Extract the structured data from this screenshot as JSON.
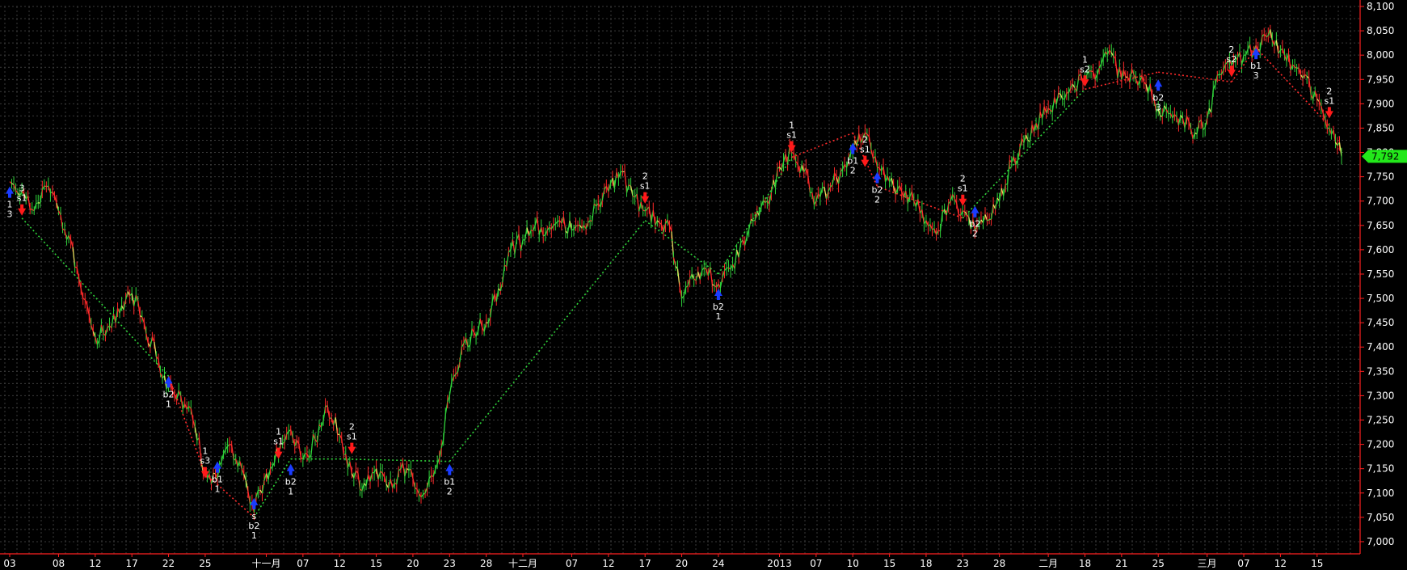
{
  "chart_data": {
    "type": "line",
    "subtype": "intraday price with swing signals",
    "ylim": [
      6975,
      8100
    ],
    "y_ticks": [
      8100,
      8050,
      8000,
      7950,
      7900,
      7850,
      7800,
      7750,
      7700,
      7650,
      7600,
      7550,
      7500,
      7450,
      7400,
      7350,
      7300,
      7250,
      7200,
      7150,
      7100,
      7050,
      7000
    ],
    "y_tick_labels": [
      "8,100",
      "8,050",
      "8,000",
      "7,950",
      "7,900",
      "7,850",
      "7,800",
      "7,750",
      "7,700",
      "7,650",
      "7,600",
      "7,550",
      "7,500",
      "7,450",
      "7,400",
      "7,350",
      "7,300",
      "7,250",
      "7,200",
      "7,150",
      "7,100",
      "7,050",
      "7,000"
    ],
    "x_axis": {
      "ticks": [
        {
          "i": 0,
          "label": "03"
        },
        {
          "i": 4,
          "label": "08"
        },
        {
          "i": 7,
          "label": "12"
        },
        {
          "i": 10,
          "label": "17"
        },
        {
          "i": 13,
          "label": "22"
        },
        {
          "i": 16,
          "label": "25"
        },
        {
          "i": 21,
          "label": "十一月"
        },
        {
          "i": 24,
          "label": "07"
        },
        {
          "i": 27,
          "label": "12"
        },
        {
          "i": 30,
          "label": "15"
        },
        {
          "i": 33,
          "label": "20"
        },
        {
          "i": 36,
          "label": "23"
        },
        {
          "i": 39,
          "label": "28"
        },
        {
          "i": 42,
          "label": "十二月"
        },
        {
          "i": 46,
          "label": "07"
        },
        {
          "i": 49,
          "label": "12"
        },
        {
          "i": 52,
          "label": "17"
        },
        {
          "i": 55,
          "label": "20"
        },
        {
          "i": 58,
          "label": "24"
        },
        {
          "i": 63,
          "label": "2013"
        },
        {
          "i": 66,
          "label": "07"
        },
        {
          "i": 69,
          "label": "10"
        },
        {
          "i": 72,
          "label": "15"
        },
        {
          "i": 75,
          "label": "18"
        },
        {
          "i": 78,
          "label": "23"
        },
        {
          "i": 81,
          "label": "28"
        },
        {
          "i": 85,
          "label": "二月"
        },
        {
          "i": 88,
          "label": "18"
        },
        {
          "i": 91,
          "label": "21"
        },
        {
          "i": 94,
          "label": "25"
        },
        {
          "i": 98,
          "label": "三月"
        },
        {
          "i": 101,
          "label": "07"
        },
        {
          "i": 104,
          "label": "12"
        },
        {
          "i": 107,
          "label": "15"
        }
      ],
      "n_sessions": 110
    },
    "series": [
      {
        "type": "price",
        "colors": {
          "up": "#2fd23a",
          "down": "#ff2a2a",
          "neutral": "#e8e060"
        },
        "points": [
          [
            0,
            7740
          ],
          [
            1,
            7720
          ],
          [
            2,
            7680
          ],
          [
            3,
            7730
          ],
          [
            4,
            7680
          ],
          [
            5,
            7620
          ],
          [
            6,
            7500
          ],
          [
            7,
            7420
          ],
          [
            8,
            7440
          ],
          [
            9,
            7470
          ],
          [
            10,
            7510
          ],
          [
            11,
            7450
          ],
          [
            12,
            7380
          ],
          [
            13,
            7320
          ],
          [
            14,
            7300
          ],
          [
            15,
            7250
          ],
          [
            16,
            7140
          ],
          [
            17,
            7130
          ],
          [
            18,
            7200
          ],
          [
            19,
            7150
          ],
          [
            20,
            7060
          ],
          [
            21,
            7140
          ],
          [
            22,
            7180
          ],
          [
            23,
            7230
          ],
          [
            24,
            7170
          ],
          [
            25,
            7210
          ],
          [
            26,
            7280
          ],
          [
            27,
            7220
          ],
          [
            28,
            7140
          ],
          [
            29,
            7120
          ],
          [
            30,
            7150
          ],
          [
            31,
            7110
          ],
          [
            32,
            7150
          ],
          [
            33,
            7130
          ],
          [
            34,
            7100
          ],
          [
            35,
            7160
          ],
          [
            36,
            7300
          ],
          [
            37,
            7400
          ],
          [
            38,
            7430
          ],
          [
            39,
            7450
          ],
          [
            40,
            7520
          ],
          [
            41,
            7600
          ],
          [
            42,
            7620
          ],
          [
            43,
            7650
          ],
          [
            44,
            7640
          ],
          [
            45,
            7660
          ],
          [
            46,
            7640
          ],
          [
            47,
            7650
          ],
          [
            48,
            7690
          ],
          [
            49,
            7720
          ],
          [
            50,
            7760
          ],
          [
            51,
            7710
          ],
          [
            52,
            7680
          ],
          [
            53,
            7660
          ],
          [
            54,
            7650
          ],
          [
            55,
            7500
          ],
          [
            56,
            7540
          ],
          [
            57,
            7560
          ],
          [
            58,
            7530
          ],
          [
            59,
            7560
          ],
          [
            60,
            7620
          ],
          [
            61,
            7660
          ],
          [
            62,
            7700
          ],
          [
            63,
            7770
          ],
          [
            64,
            7800
          ],
          [
            65,
            7760
          ],
          [
            66,
            7700
          ],
          [
            67,
            7720
          ],
          [
            68,
            7760
          ],
          [
            69,
            7800
          ],
          [
            70,
            7840
          ],
          [
            71,
            7770
          ],
          [
            72,
            7740
          ],
          [
            73,
            7720
          ],
          [
            74,
            7700
          ],
          [
            75,
            7660
          ],
          [
            76,
            7640
          ],
          [
            77,
            7700
          ],
          [
            78,
            7680
          ],
          [
            79,
            7640
          ],
          [
            80,
            7660
          ],
          [
            81,
            7700
          ],
          [
            82,
            7780
          ],
          [
            83,
            7820
          ],
          [
            84,
            7860
          ],
          [
            85,
            7890
          ],
          [
            86,
            7920
          ],
          [
            87,
            7940
          ],
          [
            88,
            7950
          ],
          [
            89,
            7960
          ],
          [
            90,
            8010
          ],
          [
            91,
            7950
          ],
          [
            92,
            7960
          ],
          [
            93,
            7940
          ],
          [
            94,
            7890
          ],
          [
            95,
            7880
          ],
          [
            96,
            7870
          ],
          [
            97,
            7840
          ],
          [
            98,
            7870
          ],
          [
            99,
            7960
          ],
          [
            100,
            7980
          ],
          [
            101,
            8000
          ],
          [
            102,
            8020
          ],
          [
            103,
            8040
          ],
          [
            104,
            8010
          ],
          [
            105,
            7980
          ],
          [
            106,
            7960
          ],
          [
            107,
            7910
          ],
          [
            108,
            7850
          ],
          [
            109,
            7792
          ]
        ]
      },
      {
        "type": "swing_link",
        "segments": [
          {
            "from": [
              1,
              7665
            ],
            "to": [
              13,
              7340
            ],
            "color": "#2fd23a"
          },
          {
            "from": [
              13,
              7340
            ],
            "to": [
              16,
              7140
            ],
            "color": "#ff2a2a"
          },
          {
            "from": [
              16,
              7140
            ],
            "to": [
              20,
              7050
            ],
            "color": "#ff2a2a"
          },
          {
            "from": [
              20,
              7050
            ],
            "to": [
              23,
              7170
            ],
            "color": "#2fd23a"
          },
          {
            "from": [
              23,
              7170
            ],
            "to": [
              27,
              7170
            ],
            "color": "#2fd23a"
          },
          {
            "from": [
              27,
              7170
            ],
            "to": [
              36,
              7165
            ],
            "color": "#2fd23a"
          },
          {
            "from": [
              36,
              7165
            ],
            "to": [
              52,
              7660
            ],
            "color": "#2fd23a"
          },
          {
            "from": [
              52,
              7660
            ],
            "to": [
              58,
              7550
            ],
            "color": "#2fd23a"
          },
          {
            "from": [
              58,
              7550
            ],
            "to": [
              64,
              7790
            ],
            "color": "#2fd23a"
          },
          {
            "from": [
              64,
              7790
            ],
            "to": [
              69,
              7840
            ],
            "color": "#ff2a2a"
          },
          {
            "from": [
              69,
              7840
            ],
            "to": [
              71,
              7730
            ],
            "color": "#ff2a2a"
          },
          {
            "from": [
              71,
              7730
            ],
            "to": [
              78,
              7665
            ],
            "color": "#ff2a2a"
          },
          {
            "from": [
              78,
              7665
            ],
            "to": [
              88,
              7930
            ],
            "color": "#2fd23a"
          },
          {
            "from": [
              88,
              7930
            ],
            "to": [
              94,
              7965
            ],
            "color": "#ff2a2a"
          },
          {
            "from": [
              94,
              7965
            ],
            "to": [
              100,
              7945
            ],
            "color": "#ff2a2a"
          },
          {
            "from": [
              100,
              7945
            ],
            "to": [
              102,
              8015
            ],
            "color": "#ff2a2a"
          },
          {
            "from": [
              102,
              8015
            ],
            "to": [
              108,
              7855
            ],
            "color": "#ff2a2a"
          }
        ]
      }
    ],
    "signals": [
      {
        "i": 0,
        "price": 7720,
        "dir": "buy",
        "labels": [
          "1",
          "3"
        ],
        "pos": "below"
      },
      {
        "i": 1,
        "price": 7680,
        "dir": "sell",
        "labels": [
          "3",
          "s1"
        ],
        "pos": "above"
      },
      {
        "i": 13,
        "price": 7330,
        "dir": "buy",
        "labels": [
          "b2",
          "1"
        ],
        "pos": "below"
      },
      {
        "i": 16,
        "price": 7140,
        "dir": "sell",
        "labels": [
          "1",
          "s3"
        ],
        "pos": "above"
      },
      {
        "i": 17,
        "price": 7155,
        "dir": "buy",
        "labels": [
          "b1",
          "1"
        ],
        "pos": "below"
      },
      {
        "i": 20,
        "price": 7080,
        "dir": "buy",
        "labels": [
          "s",
          "b2",
          "1"
        ],
        "pos": "below"
      },
      {
        "i": 22,
        "price": 7180,
        "dir": "sell",
        "labels": [
          "1",
          "s1"
        ],
        "pos": "above"
      },
      {
        "i": 23,
        "price": 7150,
        "dir": "buy",
        "labels": [
          "b2",
          "1"
        ],
        "pos": "below"
      },
      {
        "i": 28,
        "price": 7190,
        "dir": "sell",
        "labels": [
          "2",
          "s1"
        ],
        "pos": "above"
      },
      {
        "i": 36,
        "price": 7150,
        "dir": "buy",
        "labels": [
          "b1",
          "2"
        ],
        "pos": "below"
      },
      {
        "i": 52,
        "price": 7705,
        "dir": "sell",
        "labels": [
          "2",
          "s1"
        ],
        "pos": "above"
      },
      {
        "i": 58,
        "price": 7510,
        "dir": "buy",
        "labels": [
          "b2",
          "1"
        ],
        "pos": "below"
      },
      {
        "i": 64,
        "price": 7810,
        "dir": "sell",
        "labels": [
          "1",
          "s1"
        ],
        "pos": "above"
      },
      {
        "i": 69,
        "price": 7810,
        "dir": "buy",
        "labels": [
          "b1",
          "2"
        ],
        "pos": "below"
      },
      {
        "i": 70,
        "price": 7780,
        "dir": "sell",
        "labels": [
          "2",
          "s1"
        ],
        "pos": "above"
      },
      {
        "i": 71,
        "price": 7750,
        "dir": "buy",
        "labels": [
          "b2",
          "2"
        ],
        "pos": "below"
      },
      {
        "i": 78,
        "price": 7700,
        "dir": "sell",
        "labels": [
          "2",
          "s1"
        ],
        "pos": "above"
      },
      {
        "i": 79,
        "price": 7680,
        "dir": "buy",
        "labels": [
          "b2",
          "2"
        ],
        "pos": "below"
      },
      {
        "i": 88,
        "price": 7945,
        "dir": "sell",
        "labels": [
          "1",
          "s2"
        ],
        "pos": "above"
      },
      {
        "i": 94,
        "price": 7940,
        "dir": "buy",
        "labels": [
          "b2",
          "3"
        ],
        "pos": "below"
      },
      {
        "i": 100,
        "price": 7965,
        "dir": "sell",
        "labels": [
          "2",
          "s2"
        ],
        "pos": "above"
      },
      {
        "i": 102,
        "price": 8005,
        "dir": "buy",
        "labels": [
          "b1",
          "3"
        ],
        "pos": "below"
      },
      {
        "i": 108,
        "price": 7880,
        "dir": "sell",
        "labels": [
          "2",
          "s1"
        ],
        "pos": "above"
      }
    ],
    "last_price": {
      "value": 7792,
      "label": "7,792"
    },
    "grid": true
  },
  "colors": {
    "background": "#000000",
    "grid": "#3a3a3a",
    "axis": "#ff2020",
    "buy_arrow": "#1a3cff",
    "sell_arrow": "#ff1a1a",
    "last_price_bg": "#22e81a"
  }
}
